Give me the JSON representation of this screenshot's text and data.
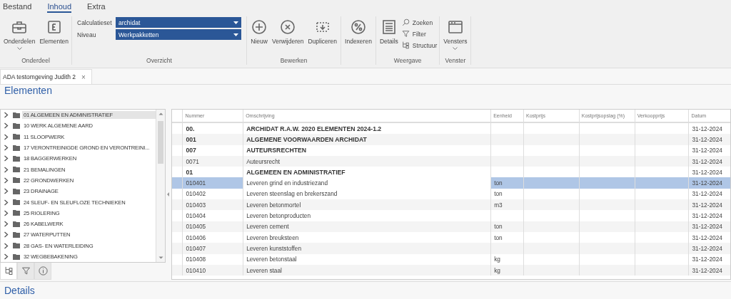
{
  "menu_tabs": [
    {
      "label": "Bestand",
      "selected": false
    },
    {
      "label": "Inhoud",
      "selected": true
    },
    {
      "label": "Extra",
      "selected": false
    }
  ],
  "ribbon": {
    "groups": [
      {
        "label": "Onderdeel",
        "items": [
          {
            "kind": "large",
            "label": "Onderdelen",
            "has_menu": true
          },
          {
            "kind": "large",
            "label": "Elementen",
            "has_menu": false
          }
        ]
      },
      {
        "label": "Overzicht",
        "items": [
          {
            "kind": "combo",
            "label": "Calculatieset",
            "value": "archidat"
          },
          {
            "kind": "combo",
            "label": "Niveau",
            "value": "Werkpakketten"
          }
        ]
      },
      {
        "label": "Bewerken",
        "items": [
          {
            "kind": "large",
            "label": "Nieuw",
            "has_menu": false
          },
          {
            "kind": "large",
            "label": "Verwijderen",
            "has_menu": false
          },
          {
            "kind": "large",
            "label": "Dupliceren",
            "has_menu": false
          }
        ]
      },
      {
        "items": [
          {
            "kind": "large",
            "label": "Indexeren",
            "has_menu": false
          }
        ]
      },
      {
        "label": "Weergave",
        "items": [
          {
            "kind": "large",
            "label": "Details",
            "has_menu": false
          },
          {
            "kind": "small",
            "label": "Zoeken"
          },
          {
            "kind": "small",
            "label": "Filter"
          },
          {
            "kind": "small",
            "label": "Structuur"
          }
        ]
      },
      {
        "label": "Venster",
        "items": [
          {
            "kind": "large",
            "label": "Vensters",
            "has_menu": true
          }
        ]
      }
    ]
  },
  "document_tabs": [
    {
      "label": "ADA testomgeving Judith 2",
      "close": "×",
      "selected": true
    }
  ],
  "section_title": "Elementen",
  "tree": {
    "items": [
      {
        "label": "01 ALGEMEEN EN ADMINISTRATIEF",
        "selected": true
      },
      {
        "label": "10 WERK ALGEMENE AARD",
        "selected": false
      },
      {
        "label": "11 SLOOPWERK",
        "selected": false
      },
      {
        "label": "17 VERONTREINIGDE GROND EN VERONTREINI...",
        "selected": false
      },
      {
        "label": "18 BAGGERWERKEN",
        "selected": false
      },
      {
        "label": "21 BEMALINGEN",
        "selected": false
      },
      {
        "label": "22 GRONDWERKEN",
        "selected": false
      },
      {
        "label": "23 DRAINAGE",
        "selected": false
      },
      {
        "label": "24 SLEUF- EN SLEUFLOZE TECHNIEKEN",
        "selected": false
      },
      {
        "label": "25 RIOLERING",
        "selected": false
      },
      {
        "label": "26 KABELWERK",
        "selected": false
      },
      {
        "label": "27 WATERPUTTEN",
        "selected": false
      },
      {
        "label": "28 GAS- EN WATERLEIDING",
        "selected": false
      },
      {
        "label": "32 WEGBEBAKENING",
        "selected": false
      }
    ],
    "tabs": [
      {
        "selected": true
      },
      {
        "selected": false
      },
      {
        "selected": false
      }
    ]
  },
  "grid": {
    "columns": [
      {
        "label": "Nummer",
        "focused": false
      },
      {
        "label": "Omschrijving",
        "focused": true
      },
      {
        "label": "Eenheid",
        "focused": false
      },
      {
        "label": "Kostprijs",
        "focused": false
      },
      {
        "label": "Kostprijsopslag (%)",
        "focused": false
      },
      {
        "label": "Verkoopprijs",
        "focused": false
      },
      {
        "label": "Datum",
        "focused": false
      }
    ],
    "rows": [
      {
        "kind": "heading",
        "selected": false,
        "number": "00.",
        "description": "ARCHIDAT R.A.W. 2020 ELEMENTEN 2024-1.2",
        "date": "31-12-2024"
      },
      {
        "kind": "heading",
        "selected": false,
        "number": "001",
        "description": "ALGEMENE VOORWAARDEN ARCHIDAT",
        "date": "31-12-2024"
      },
      {
        "kind": "heading",
        "selected": false,
        "number": "007",
        "description": "AUTEURSRECHTEN",
        "date": "31-12-2024"
      },
      {
        "kind": "item",
        "selected": false,
        "number": "0071",
        "description": "Auteursrecht",
        "date": "31-12-2024"
      },
      {
        "kind": "heading",
        "selected": false,
        "number": "01",
        "description": "ALGEMEEN EN ADMINISTRATIEF",
        "date": "31-12-2024"
      },
      {
        "kind": "item",
        "selected": true,
        "number": "010401",
        "description": "Leveren grind en industriezand",
        "unit": "ton",
        "date": "31-12-2024"
      },
      {
        "kind": "item",
        "selected": false,
        "number": "010402",
        "description": "Leveren steenslag en brekerszand",
        "unit": "ton",
        "date": "31-12-2024"
      },
      {
        "kind": "item",
        "selected": false,
        "number": "010403",
        "description": "Leveren betonmortel",
        "unit": "m3",
        "date": "31-12-2024"
      },
      {
        "kind": "item",
        "selected": false,
        "number": "010404",
        "description": "Leveren betonproducten",
        "date": "31-12-2024"
      },
      {
        "kind": "item",
        "selected": false,
        "number": "010405",
        "description": "Leveren cement",
        "unit": "ton",
        "date": "31-12-2024"
      },
      {
        "kind": "item",
        "selected": false,
        "number": "010406",
        "description": "Leveren breuksteen",
        "unit": "ton",
        "date": "31-12-2024"
      },
      {
        "kind": "item",
        "selected": false,
        "number": "010407",
        "description": "Leveren kunststoffen",
        "date": "31-12-2024"
      },
      {
        "kind": "item",
        "selected": false,
        "number": "010408",
        "description": "Leveren betonstaal",
        "unit": "kg",
        "date": "31-12-2024"
      },
      {
        "kind": "item",
        "selected": false,
        "number": "010410",
        "description": "Leveren staal",
        "unit": "kg",
        "date": "31-12-2024"
      }
    ]
  },
  "details_title": "Details"
}
